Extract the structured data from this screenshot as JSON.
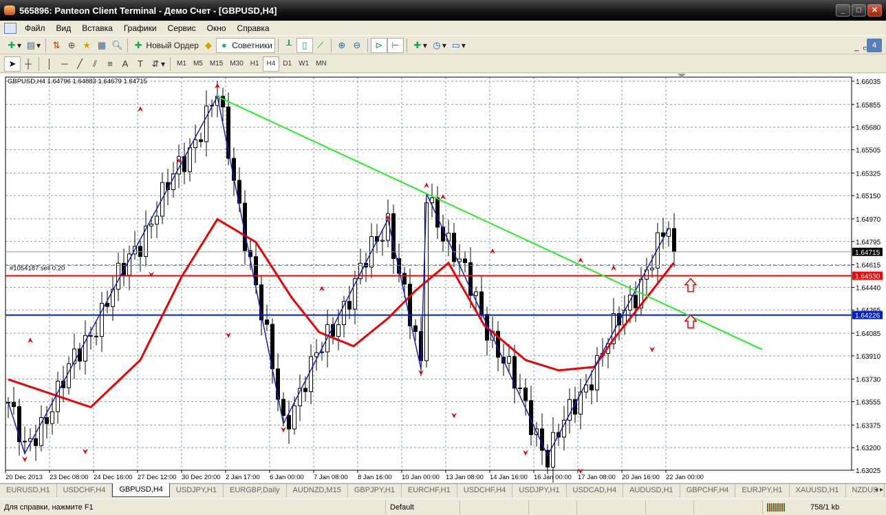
{
  "window": {
    "title": "565896: Panteon Client Terminal - Демо Счет - [GBPUSD,H4]"
  },
  "menu": [
    "Файл",
    "Вид",
    "Вставка",
    "Графики",
    "Сервис",
    "Окно",
    "Справка"
  ],
  "toolbar": {
    "new_order": "Новый Ордер",
    "experts": "Советники"
  },
  "timeframes": [
    "M1",
    "M5",
    "M15",
    "M30",
    "H1",
    "H4",
    "D1",
    "W1",
    "MN"
  ],
  "active_timeframe": "H4",
  "chart": {
    "info": "GBPUSD,H4  1.64796 1.64883 1.64679 1.64715",
    "order_label": "#1054187 sell 0.20",
    "price_ticks": [
      "1.66035",
      "1.65855",
      "1.65680",
      "1.65505",
      "1.65325",
      "1.65150",
      "1.64970",
      "1.64795",
      "1.64615",
      "1.64440",
      "1.64265",
      "1.64085",
      "1.63910",
      "1.63730",
      "1.63555",
      "1.63375",
      "1.63200",
      "1.63025"
    ],
    "price_range": [
      1.63025,
      1.66035
    ],
    "current_price": "1.64715",
    "red_level": "1.64530",
    "blue_level": "1.64226",
    "green_dashed_level": 1.6461,
    "time_labels": [
      "20 Dec 2013",
      "23 Dec 08:00",
      "24 Dec 16:00",
      "27 Dec 12:00",
      "30 Dec 20:00",
      "2 Jan 17:00",
      "6 Jan 00:00",
      "7 Jan 08:00",
      "8 Jan 16:00",
      "10 Jan 00:00",
      "13 Jan 08:00",
      "14 Jan 16:00",
      "16 Jan 00:00",
      "17 Jan 08:00",
      "20 Jan 16:00",
      "22 Jan 00:00"
    ],
    "bars_per_label": 8,
    "total_slots": 153,
    "zigzag": [
      [
        0,
        1.6355
      ],
      [
        3,
        1.63154
      ],
      [
        38,
        1.65917
      ],
      [
        50,
        1.63385
      ],
      [
        69,
        1.64967
      ],
      [
        75,
        1.63808
      ],
      [
        76,
        1.65166
      ],
      [
        98,
        1.63138
      ],
      [
        120,
        1.64898
      ]
    ],
    "ma": [
      [
        0,
        1.63728
      ],
      [
        15,
        1.63513
      ],
      [
        24,
        1.63878
      ],
      [
        31.5,
        1.64522
      ],
      [
        38,
        1.64967
      ],
      [
        45,
        1.6479
      ],
      [
        51.5,
        1.64361
      ],
      [
        56.5,
        1.64093
      ],
      [
        62.75,
        1.63985
      ],
      [
        69,
        1.642
      ],
      [
        74,
        1.64415
      ],
      [
        80,
        1.64629
      ],
      [
        86.5,
        1.64146
      ],
      [
        94,
        1.63878
      ],
      [
        100,
        1.63798
      ],
      [
        106.5,
        1.63824
      ],
      [
        110,
        1.64039
      ],
      [
        116.5,
        1.64388
      ],
      [
        120.9,
        1.64629
      ]
    ],
    "trendline": [
      [
        38,
        1.65917
      ],
      [
        137,
        1.63959
      ]
    ],
    "fractals_up": [
      [
        4,
        1.6403
      ],
      [
        24,
        1.6582
      ],
      [
        31,
        1.6542
      ],
      [
        38,
        1.66
      ],
      [
        57,
        1.6443
      ],
      [
        69,
        1.6498
      ],
      [
        76,
        1.6523
      ],
      [
        79,
        1.6514
      ],
      [
        88,
        1.6472
      ],
      [
        104,
        1.6465
      ],
      [
        110,
        1.6459
      ]
    ],
    "fractals_down": [
      [
        3,
        1.6311
      ],
      [
        14,
        1.6317
      ],
      [
        26,
        1.6454
      ],
      [
        40,
        1.6407
      ],
      [
        50,
        1.6334
      ],
      [
        75,
        1.6378
      ],
      [
        81,
        1.6345
      ],
      [
        94,
        1.6316
      ],
      [
        104,
        1.6302
      ],
      [
        108,
        1.6391
      ],
      [
        117,
        1.6396
      ]
    ],
    "signal_arrows": [
      [
        124,
        1.6446
      ],
      [
        124,
        1.6418
      ]
    ]
  },
  "tabs": [
    "EURUSD,H1",
    "USDCHF,H4",
    "GBPUSD,H4",
    "USDJPY,H1",
    "EURGBP,Daily",
    "AUDNZD,M15",
    "GBPJPY,H1",
    "EURCHF,H1",
    "USDCHF,H4",
    "USDJPY,H1",
    "USDCAD,H4",
    "AUDUSD,H1",
    "GBPCHF,H4",
    "EURJPY,H1",
    "XAUUSD,H1",
    "NZDUS"
  ],
  "active_tab": 2,
  "status": {
    "help": "Для справки, нажмите F1",
    "profile": "Default",
    "traffic": "758/1 kb"
  }
}
